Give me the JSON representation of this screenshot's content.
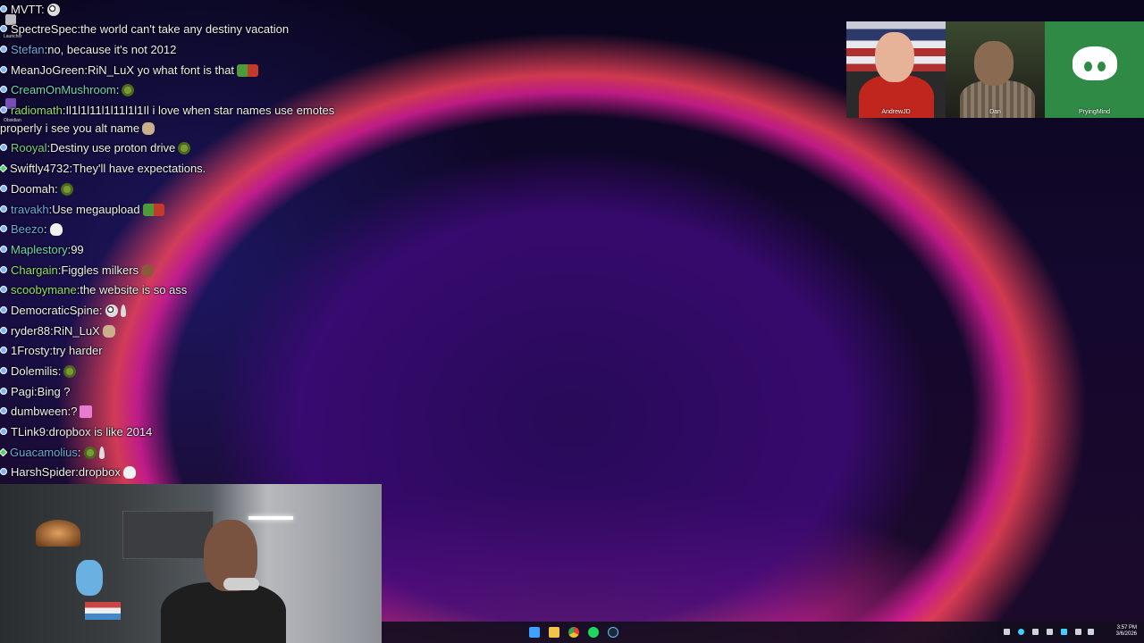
{
  "chat": {
    "messages": [
      {
        "user": "MVTT",
        "user_color": "#efeff1",
        "text": "",
        "badge": "blue",
        "emotes": [
          "face"
        ]
      },
      {
        "user": "SpectreSpec",
        "user_color": "#efeff1",
        "text": "the world can't take any destiny vacation",
        "badge": "blue",
        "emotes": []
      },
      {
        "user": "Stefan",
        "user_color": "#6aa9e0",
        "text": "no, because it's not 2012",
        "badge": "blue",
        "emotes": []
      },
      {
        "user": "MeanJoGreen",
        "user_color": "#efeff1",
        "text": "RiN_LuX yo what font is that",
        "badge": "blue",
        "emotes": [
          "red"
        ]
      },
      {
        "user": "CreamOnMushroom",
        "user_color": "#6fd5b0",
        "text": "",
        "badge": "blue",
        "emotes": [
          "spiky"
        ]
      },
      {
        "user": "radiomath",
        "user_color": "#8fe06a",
        "text": "Il1l1l11l1l11l1l1Il i love when star names use emotes",
        "text2": "properly i see you alt name",
        "badge": "blue",
        "emotes": [
          "hand"
        ]
      },
      {
        "user": "Rooyal",
        "user_color": "#7ad08a",
        "text": "Destiny use proton drive",
        "badge": "blue",
        "emotes": [
          "spiky"
        ]
      },
      {
        "user": "Swiftly4732",
        "user_color": "#efeff1",
        "text": "They'll have expectations.",
        "badge": "green",
        "emotes": []
      },
      {
        "user": "Doomah",
        "user_color": "#efeff1",
        "text": "",
        "badge": "blue",
        "emotes": [
          "spiky"
        ]
      },
      {
        "user": "travakh",
        "user_color": "#6aa9e0",
        "text": "Use megaupload",
        "badge": "blue",
        "emotes": [
          "red"
        ]
      },
      {
        "user": "Beezo",
        "user_color": "#6aa9e0",
        "text": "",
        "badge": "blue",
        "emotes": [
          "ghost"
        ]
      },
      {
        "user": "Maplestory",
        "user_color": "#6fd5b0",
        "text": "99",
        "badge": "blue",
        "emotes": []
      },
      {
        "user": "Chargain",
        "user_color": "#8fe06a",
        "text": "Figgles milkers",
        "badge": "blue",
        "emotes": [
          "brown"
        ]
      },
      {
        "user": "scoobymane",
        "user_color": "#8fe06a",
        "text": "the website is so ass",
        "badge": "blue",
        "emotes": []
      },
      {
        "user": "DemocraticSpine",
        "user_color": "#efeff1",
        "text": "",
        "badge": "blue",
        "emotes": [
          "face",
          "feather"
        ]
      },
      {
        "user": "ryder88",
        "user_color": "#efeff1",
        "text": "RiN_LuX",
        "badge": "blue",
        "emotes": [
          "hand"
        ]
      },
      {
        "user": "1Frosty",
        "user_color": "#efeff1",
        "text": "try harder",
        "badge": "blue",
        "emotes": []
      },
      {
        "user": "Dolemilis",
        "user_color": "#efeff1",
        "text": "",
        "badge": "blue",
        "emotes": [
          "spiky"
        ]
      },
      {
        "user": "Pagi",
        "user_color": "#efeff1",
        "text": "Bing ?",
        "badge": "blue",
        "emotes": []
      },
      {
        "user": "dumbween",
        "user_color": "#efeff1",
        "text": "?",
        "badge": "blue",
        "emotes": [
          "pink"
        ]
      },
      {
        "user": "TLink9",
        "user_color": "#efeff1",
        "text": "dropbox is like 2014",
        "badge": "blue",
        "emotes": []
      },
      {
        "user": "Guacamolius",
        "user_color": "#6aa9e0",
        "text": "",
        "badge": "green",
        "emotes": [
          "spiky",
          "feather"
        ]
      },
      {
        "user": "HarshSpider",
        "user_color": "#efeff1",
        "text": "dropbox",
        "badge": "blue",
        "emotes": [
          "ghost"
        ]
      }
    ]
  },
  "desktop_icons": [
    {
      "label": "Launcher",
      "icon": "app-icon"
    },
    {
      "label": "Obsidian",
      "icon": "obsidian-icon"
    }
  ],
  "participants": [
    {
      "name": "AndrewJD"
    },
    {
      "name": "Dan"
    },
    {
      "name": "PryingMind"
    }
  ],
  "taskbar": {
    "apps": [
      "windows-start-icon",
      "file-explorer-icon",
      "chrome-icon",
      "spotify-icon",
      "steam-icon"
    ],
    "time": "3:57 PM",
    "date": "3/6/2026"
  }
}
